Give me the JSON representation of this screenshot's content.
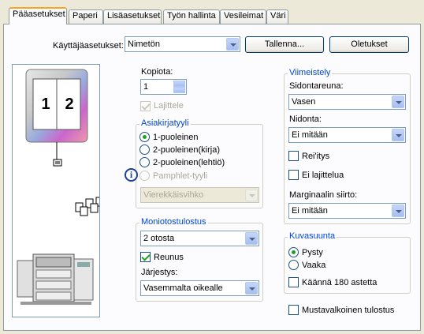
{
  "tabs": [
    {
      "label": "Pääasetukset"
    },
    {
      "label": "Paperi"
    },
    {
      "label": "Lisäasetukset"
    },
    {
      "label": "Työn hallinta"
    },
    {
      "label": "Vesileimat"
    },
    {
      "label": "Väri"
    }
  ],
  "user_settings": {
    "label": "Käyttäjäasetukset:",
    "value": "Nimetön",
    "save_button": "Tallenna...",
    "defaults_button": "Oletukset"
  },
  "preview": {
    "page_left": "1",
    "page_right": "2"
  },
  "copies": {
    "label": "Kopiota:",
    "value": "1",
    "collate_label": "Lajittele"
  },
  "document_style": {
    "legend": "Asiakirjatyyli",
    "options": [
      "1-puoleinen",
      "2-puoleinen(kirja)",
      "2-puoleinen(lehtiö)",
      "Pamphlet-tyyli"
    ],
    "selected_index": 0,
    "pamphlet_select": "Vierekkäisvihko"
  },
  "nup": {
    "legend": "Moniotostulostus",
    "value": "2 otosta",
    "border_label": "Reunus",
    "order_label": "Järjestys:",
    "order_value": "Vasemmalta oikealle"
  },
  "finishing": {
    "legend": "Viimeistely",
    "binding_edge_label": "Sidontareuna:",
    "binding_edge_value": "Vasen",
    "binding_label": "Nidonta:",
    "binding_value": "Ei mitään",
    "punch_label": "Rei'itys",
    "no_offset_label": "Ei lajittelua",
    "margin_shift_label": "Marginaalin siirto:",
    "margin_shift_value": "Ei mitään"
  },
  "orientation": {
    "legend": "Kuvasuunta",
    "options": [
      "Pysty",
      "Vaaka"
    ],
    "selected_index": 0,
    "rotate_label": "Käännä 180 astetta"
  },
  "monochrome_label": "Mustavalkoinen tulostus",
  "colors": {
    "legend_blue": "#0046d5",
    "check_green": "#21a121",
    "selection_blue": "#316ac5"
  }
}
